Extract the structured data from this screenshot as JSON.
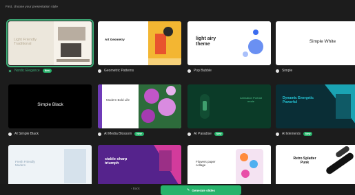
{
  "prompt": "First, choose your presentation style",
  "templates": [
    {
      "label": "Nordic Elegance",
      "badge": "New",
      "title": "Light Friendly Traditional"
    },
    {
      "label": "Geometric Patterns",
      "badge": "",
      "title": "Art Geometry"
    },
    {
      "label": "Pop Bubble",
      "badge": "",
      "title": "light airy theme"
    },
    {
      "label": "Simple",
      "badge": "",
      "title": "Simple White"
    },
    {
      "label": "AI Simple Black",
      "badge": "",
      "title": "Simple Black"
    },
    {
      "label": "AI Media Blossom",
      "badge": "New",
      "title": "Modern Bold Life"
    },
    {
      "label": "AI Paradise",
      "badge": "New",
      "title": "Animation Portrait mode"
    },
    {
      "label": "AI Elements",
      "badge": "New",
      "title": "Dynamic Energetic Powerful"
    },
    {
      "label": "",
      "badge": "",
      "title": "Fresh Friendly Modern"
    },
    {
      "label": "",
      "badge": "",
      "title": "stable sharp triumph"
    },
    {
      "label": "",
      "badge": "",
      "title": "Flowers paper collage"
    },
    {
      "label": "",
      "badge": "",
      "title": "Retro Splatter Punk"
    }
  ],
  "footer": {
    "back_label": "Back",
    "generate_label": "Generate slides"
  },
  "colors": {
    "accent": "#26b36b",
    "background": "#1c1c1c"
  }
}
